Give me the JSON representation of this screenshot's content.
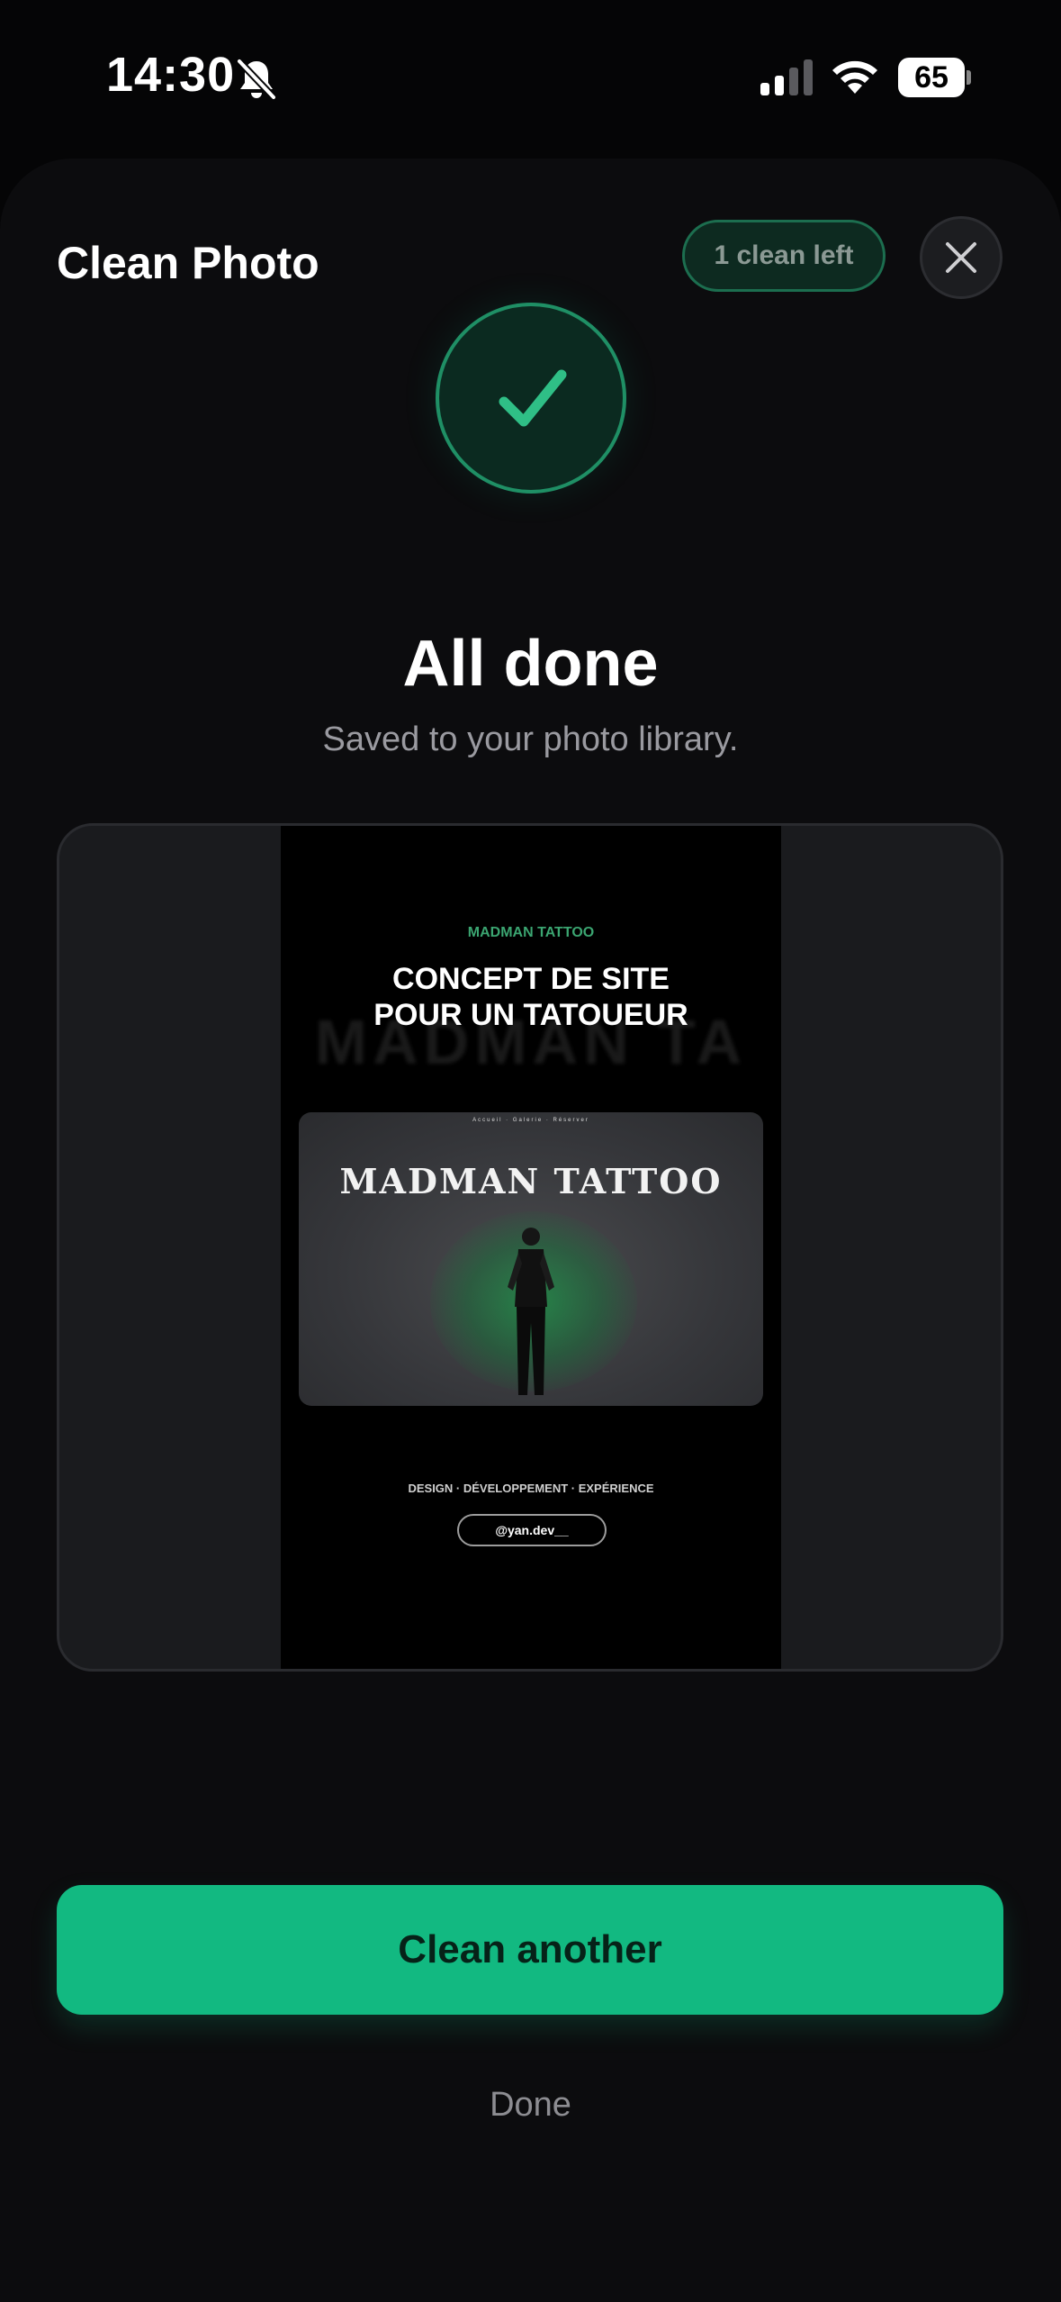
{
  "status_bar": {
    "time": "14:30",
    "battery": "65",
    "icons": [
      "bell-slash-icon",
      "cellular-signal-icon",
      "wifi-icon",
      "battery-icon"
    ]
  },
  "header": {
    "title": "Clean Photo",
    "badge": "1 clean left",
    "close_icon": "close-icon"
  },
  "result": {
    "icon": "checkmark-icon",
    "heading": "All done",
    "subtitle": "Saved to your photo library."
  },
  "preview": {
    "brand": "MADMAN TATTOO",
    "headline_line1": "CONCEPT DE SITE",
    "headline_line2": "POUR UN TATOUEUR",
    "ghost_text": "MADMAN TA",
    "hero_nav": "Accueil · Galerie · Réserver",
    "hero_title": "MADMAN TATTOO",
    "tagline": "DESIGN · DÉVELOPPEMENT · EXPÉRIENCE",
    "handle": "@yan.dev__"
  },
  "actions": {
    "primary": "Clean another",
    "secondary": "Done"
  },
  "colors": {
    "accent": "#12b981",
    "background": "#0c0c0e"
  }
}
